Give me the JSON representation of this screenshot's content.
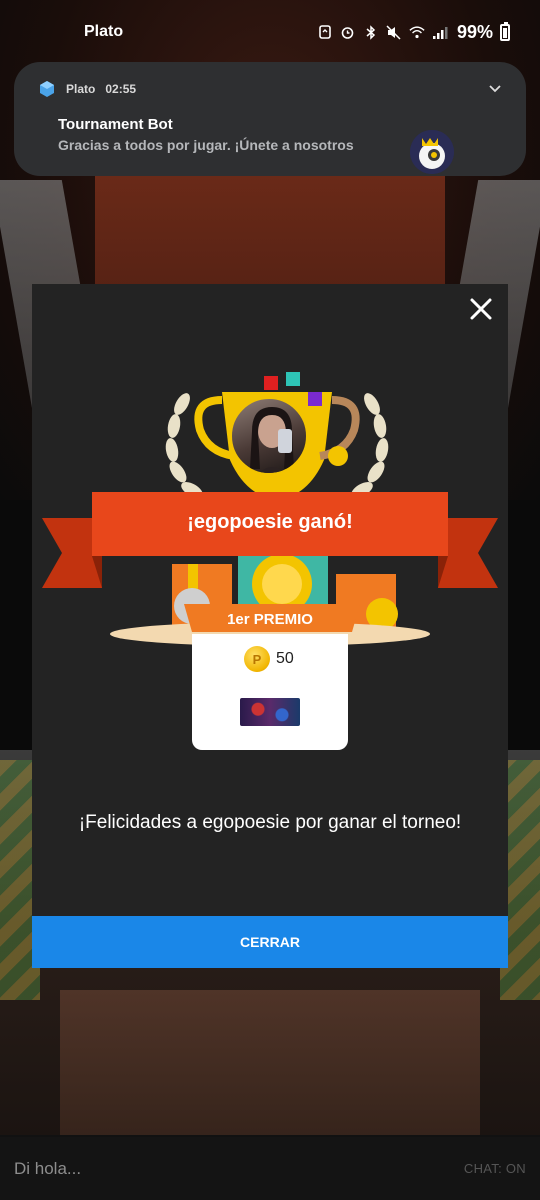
{
  "status_bar": {
    "app_name": "Plato",
    "battery": "99%"
  },
  "notification": {
    "app": "Plato",
    "time": "02:55",
    "title": "Tournament Bot",
    "message": "Gracias a todos por jugar. ¡Únete a nosotros"
  },
  "modal": {
    "banner": "¡egopoesie ganó!",
    "prize_label": "1er PREMIO",
    "coin_symbol": "P",
    "coin_amount": "50",
    "congrats": "¡Felicidades a egopoesie por ganar el torneo!",
    "close_button": "CERRAR"
  },
  "chat": {
    "placeholder": "Di hola...",
    "toggle": "CHAT: ON"
  },
  "colors": {
    "banner_red": "#e8471b",
    "button_blue": "#1a87e8",
    "modal_bg": "#232323",
    "gold": "#f3c400"
  },
  "icons": [
    "alarm-icon",
    "bluetooth-icon",
    "mute-icon",
    "wifi-icon",
    "signal-icon",
    "battery-icon",
    "close-icon",
    "chevron-down-icon",
    "coin-icon",
    "trophy-icon"
  ]
}
